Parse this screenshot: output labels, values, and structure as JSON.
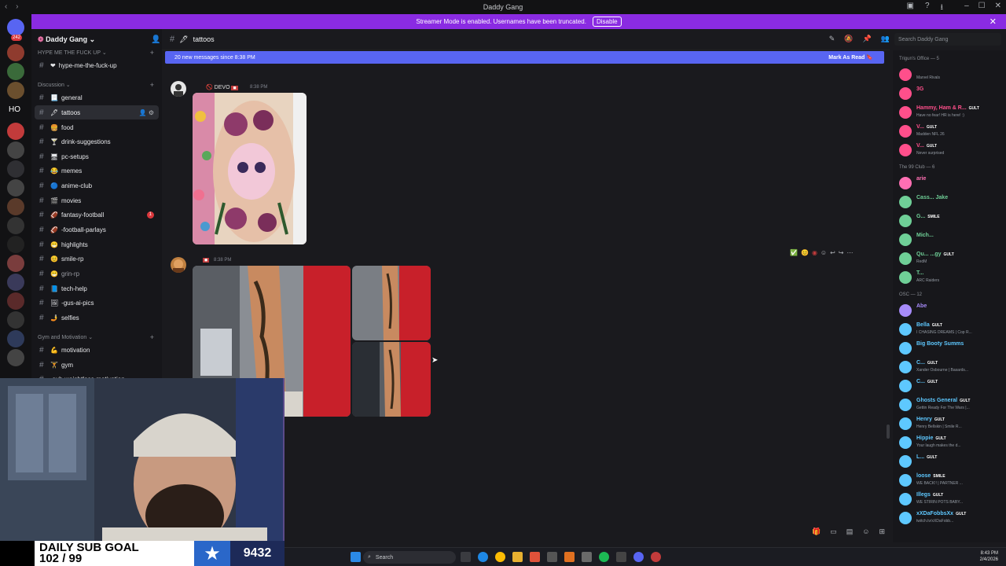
{
  "titlebar": {
    "title": "Daddy Gang"
  },
  "banner": {
    "text": "Streamer Mode is enabled. Usernames have been truncated.",
    "disable_label": "Disable"
  },
  "rail": {
    "badges": [
      "242",
      "32",
      "12",
      "9",
      "3",
      "110",
      "96",
      "380",
      "45",
      "49",
      "953",
      "72",
      "313",
      "668",
      "7K+"
    ],
    "initial": "HO"
  },
  "server": {
    "name": "Daddy Gang"
  },
  "categories": [
    {
      "label": "HYPE ME THE FUCK UP"
    },
    {
      "label": "Discussion"
    },
    {
      "label": "Gym and Motivation"
    }
  ],
  "channels": [
    {
      "name": "hype-me-the-fuck-up",
      "emoji": "❤"
    },
    {
      "name": "general",
      "emoji": "📃"
    },
    {
      "name": "tattoos",
      "emoji": "🖋"
    },
    {
      "name": "food",
      "emoji": "🍔"
    },
    {
      "name": "drink-suggestions",
      "emoji": "🍸"
    },
    {
      "name": "pc-setups",
      "emoji": "🖥"
    },
    {
      "name": "memes",
      "emoji": "😂"
    },
    {
      "name": "anime-club",
      "emoji": "🔵"
    },
    {
      "name": "movies",
      "emoji": "🎬"
    },
    {
      "name": "fantasy-football",
      "emoji": "🏈",
      "badge": "1"
    },
    {
      "name": "-football-parlays",
      "emoji": "🏈"
    },
    {
      "name": "highlights",
      "emoji": "😁"
    },
    {
      "name": "smile-rp",
      "emoji": "😊"
    },
    {
      "name": "grin-rp",
      "emoji": "😁"
    },
    {
      "name": "tech-help",
      "emoji": "📘"
    },
    {
      "name": "-gus-ai-pics",
      "emoji": "🖼"
    },
    {
      "name": "selfies",
      "emoji": "🤳"
    },
    {
      "name": "motivation",
      "emoji": "💪"
    },
    {
      "name": "gym",
      "emoji": "🏋"
    },
    {
      "name": "-sub-weightloss-motivation",
      "emoji": ""
    }
  ],
  "header": {
    "channel": "tattoos",
    "search_placeholder": "Search Daddy Gang"
  },
  "newmessages": {
    "text": "20 new messages since 8:38 PM",
    "action": "Mark As Read"
  },
  "messages": [
    {
      "name": "DEVO",
      "time": "8:38 PM"
    },
    {
      "name": "",
      "time": "8:38 PM"
    }
  ],
  "members": {
    "groups": [
      {
        "label": "Trigun's Office — 5",
        "members": [
          {
            "name": "",
            "status": "Marvel Rivals",
            "color": "#ff4f8b"
          },
          {
            "name": "3G",
            "status": "",
            "color": "#ff4f8b"
          },
          {
            "name": "Hammy, Ham & R...",
            "tag": "GULT",
            "status": "Have no fear! HR is here! :)",
            "color": "#ff4f8b"
          },
          {
            "name": "V...",
            "tag": "GULT",
            "status": "Madden NFL 26",
            "color": "#ff4f8b"
          },
          {
            "name": "V...",
            "tag": "GULT",
            "status": "Never surprised",
            "color": "#ff4f8b"
          }
        ]
      },
      {
        "label": "The 99 Club — 6",
        "members": [
          {
            "name": "arie",
            "status": "",
            "color": "#ff6fb3"
          },
          {
            "name": "Cass... Jake",
            "status": "",
            "color": "#6fcf97"
          },
          {
            "name": "G...",
            "tag": "SMILE",
            "status": "",
            "color": "#6fcf97"
          },
          {
            "name": "Mich...",
            "status": "",
            "color": "#6fcf97"
          },
          {
            "name": "Qu... ...gy",
            "tag": "GULT",
            "status": "RedM",
            "color": "#6fcf97"
          },
          {
            "name": "T...",
            "status": "ARC Raiders",
            "color": "#6fcf97"
          }
        ]
      },
      {
        "label": "OSC — 12",
        "members": [
          {
            "name": "Abe",
            "status": "",
            "color": "#a78bfa"
          },
          {
            "name": "Bella",
            "tag": "GULT",
            "status": "I CHASING DREAMS | Cop R...",
            "color": "#5ec8ff"
          },
          {
            "name": "Big Booty Summs",
            "status": "",
            "color": "#5ec8ff"
          },
          {
            "name": "C...",
            "tag": "GULT",
            "status": "Xander Osbourne | Basards...",
            "color": "#5ec8ff"
          },
          {
            "name": "C...",
            "tag": "GULT",
            "status": "",
            "color": "#5ec8ff"
          },
          {
            "name": "Ghosts General",
            "tag": "GULT",
            "status": "Gettin Ready For The Wars |...",
            "color": "#5ec8ff"
          },
          {
            "name": "Henry",
            "tag": "GULT",
            "status": "Henry Bellskin | Smile R...",
            "color": "#5ec8ff"
          },
          {
            "name": "Hippie",
            "tag": "GULT",
            "status": "Your laugh makes the d...",
            "color": "#5ec8ff"
          },
          {
            "name": "L...",
            "tag": "GULT",
            "status": "",
            "color": "#5ec8ff"
          },
          {
            "name": "loose",
            "tag": "SMILE",
            "status": "WE BACK!! | PARTNER ...",
            "color": "#5ec8ff"
          },
          {
            "name": "Illegs",
            "tag": "GULT",
            "status": "WE STIRIN POTS BABY...",
            "color": "#5ec8ff"
          },
          {
            "name": "xXDaFobbsXx",
            "tag": "GULT",
            "status": "twitch.tv/xXDaFobb...",
            "color": "#5ec8ff"
          }
        ]
      }
    ]
  },
  "goal": {
    "label1": "DAILY SUB GOAL",
    "label2": "102 / 99",
    "count": "9432"
  },
  "taskbar": {
    "search": "Search",
    "time": "8:43 PM",
    "date": "2/4/2026"
  }
}
